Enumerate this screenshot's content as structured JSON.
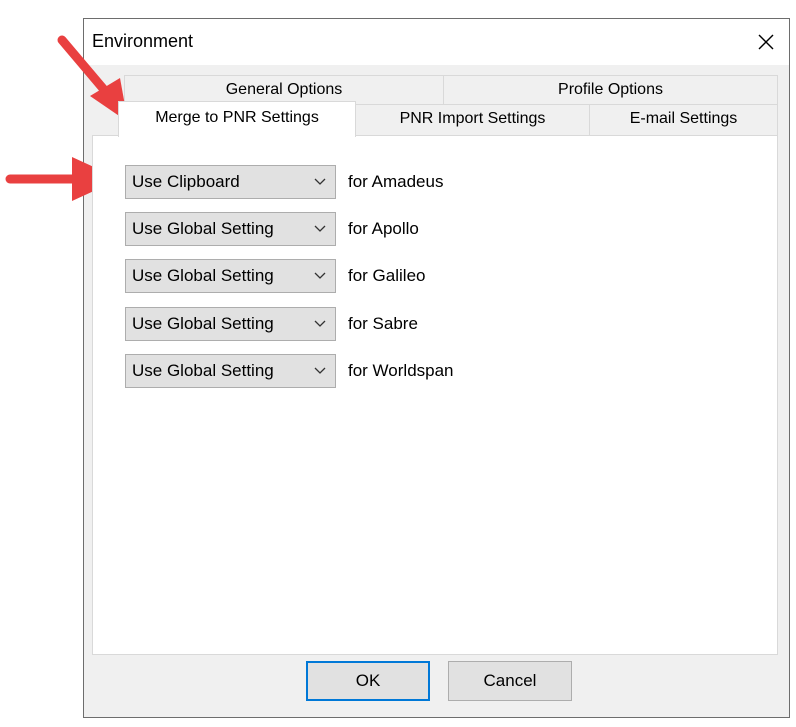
{
  "window": {
    "title": "Environment"
  },
  "icons": {
    "close": "close-icon",
    "dropdown": "chevron-down-icon",
    "annotation": "red-arrow-icon"
  },
  "colors": {
    "dialog_bg": "#f0f0f0",
    "panel_bg": "#ffffff",
    "focus_border": "#0078d7",
    "arrow": "#e94040"
  },
  "tabs": {
    "back_row": [
      {
        "label": "General Options"
      },
      {
        "label": "Profile Options"
      }
    ],
    "front_row": [
      {
        "label": "Merge to PNR Settings",
        "active": true
      },
      {
        "label": "PNR Import Settings"
      },
      {
        "label": "E-mail Settings"
      }
    ]
  },
  "settings": [
    {
      "value": "Use Clipboard",
      "label": "for Amadeus"
    },
    {
      "value": "Use Global Setting",
      "label": "for Apollo"
    },
    {
      "value": "Use Global Setting",
      "label": "for Galileo"
    },
    {
      "value": "Use Global Setting",
      "label": "for Sabre"
    },
    {
      "value": "Use Global Setting",
      "label": "for Worldspan"
    }
  ],
  "buttons": {
    "ok": "OK",
    "cancel": "Cancel"
  }
}
